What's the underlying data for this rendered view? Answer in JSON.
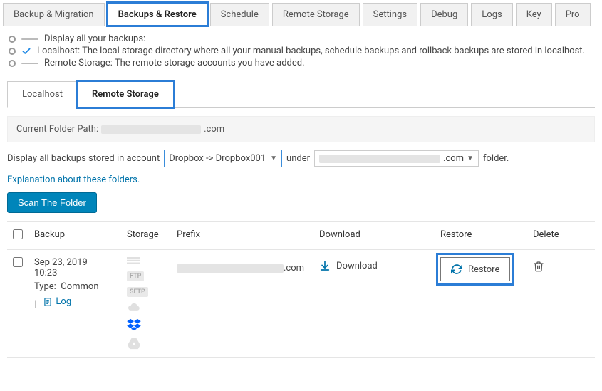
{
  "nav": [
    {
      "label": "Backup & Migration"
    },
    {
      "label": "Backups & Restore",
      "active": true,
      "highlight": true
    },
    {
      "label": "Schedule"
    },
    {
      "label": "Remote Storage"
    },
    {
      "label": "Settings"
    },
    {
      "label": "Debug"
    },
    {
      "label": "Logs"
    },
    {
      "label": "Key"
    },
    {
      "label": "Pro"
    }
  ],
  "intro": {
    "line1": "Display all your backups:",
    "line2": "Localhost: The local storage directory where all your manual backups, schedule backups and rollback backups are stored in localhost.",
    "line3": "Remote Storage: The remote storage accounts you have added."
  },
  "subtabs": {
    "localhost": "Localhost",
    "remote": "Remote Storage"
  },
  "folderPath": {
    "label": "Current Folder Path:",
    "suffix": ".com"
  },
  "accountLine": {
    "prefix": "Display all backups stored in account",
    "selected": "Dropbox -> Dropbox001",
    "under": "under",
    "domainSuffix": ".com",
    "folderWord": "folder."
  },
  "explanationLink": "Explanation about these folders.",
  "scanButton": "Scan The Folder",
  "tableHead": {
    "backup": "Backup",
    "storage": "Storage",
    "prefix": "Prefix",
    "download": "Download",
    "restore": "Restore",
    "delete": "Delete"
  },
  "row": {
    "date": "Sep 23, 2019",
    "time": "10:23",
    "typeLabel": "Type:",
    "typeValue": "Common",
    "logLabel": "Log",
    "prefixSuffix": ".com",
    "downloadLabel": "Download",
    "restoreLabel": "Restore"
  },
  "storageBadges": [
    "",
    "FTP",
    "SFTP"
  ]
}
